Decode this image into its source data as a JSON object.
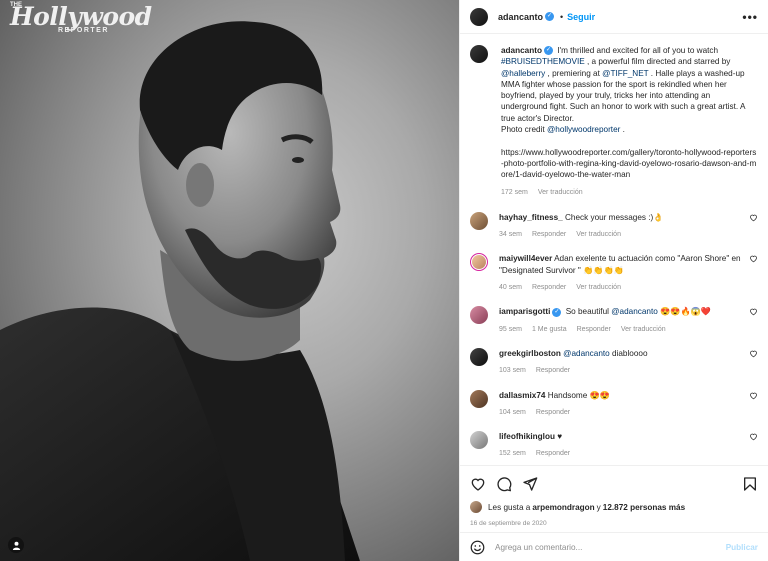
{
  "photo": {
    "masthead_the": "THE",
    "masthead": "Hollywood",
    "masthead_sub": "REPORTER"
  },
  "header": {
    "username": "adancanto",
    "separator": "•",
    "follow_label": "Seguir",
    "more": "•••"
  },
  "caption": {
    "username": "adancanto",
    "text_1": " I'm thrilled and excited for all of you to watch ",
    "hashtag": "#BRUISEDTHEMOVIE",
    "text_2": " , a powerful film directed and starred by ",
    "mention_1": "@halleberry",
    "text_3": " , premiering at ",
    "mention_2": "@TIFF_NET",
    "text_4": " . Halle plays a washed-up MMA fighter whose passion for the sport is rekindled when her boyfriend, played by your truly, tricks her into attending an underground fight. Such an honor to work with such a great artist. A true actor's Director.",
    "photo_credit": "Photo credit ",
    "mention_3": "@hollywoodreporter",
    "text_5": " .",
    "url": "https://www.hollywoodreporter.com/gallery/toronto-hollywood-reporters-photo-portfolio-with-regina-king-david-oyelowo-rosario-dawson-and-more/1-david-oyelowo-the-water-man",
    "time": "172 sem",
    "translate": "Ver traducción"
  },
  "comments": [
    {
      "username": "hayhay_fitness_",
      "text": " Check your messages :)👌",
      "time": "34 sem",
      "likes": "",
      "reply": "Responder",
      "translate": "Ver traducción"
    },
    {
      "username": "maiywill4ever",
      "text": " Adan exelente tu actuación como \"Aaron Shore\" en \"Designated Survivor \" 👏👏👏👏",
      "time": "40 sem",
      "likes": "",
      "reply": "Responder",
      "translate": "Ver traducción"
    },
    {
      "username": "iamparisgotti",
      "text_pre": " So beautiful ",
      "mention": "@adancanto",
      "text_post": " 😍😍🔥😱❤️",
      "time": "95 sem",
      "likes": "1 Me gusta",
      "reply": "Responder",
      "translate": "Ver traducción"
    },
    {
      "username": "greekgirlboston",
      "text_pre": " ",
      "mention": "@adancanto",
      "text_post": " diabloooo",
      "time": "103 sem",
      "reply": "Responder"
    },
    {
      "username": "dallasmix74",
      "text": " Handsome 😍😍",
      "time": "104 sem",
      "reply": "Responder"
    },
    {
      "username": "lifeofhikinglou",
      "text": " ♥",
      "time": "152 sem",
      "reply": "Responder"
    }
  ],
  "likes": {
    "prefix": "Les gusta a ",
    "user": "arpemondragon",
    "middle": " y ",
    "count": "12.872 personas más"
  },
  "date": "16 de septiembre de 2020",
  "add_comment": {
    "placeholder": "Agrega un comentario...",
    "publish_label": "Publicar"
  }
}
